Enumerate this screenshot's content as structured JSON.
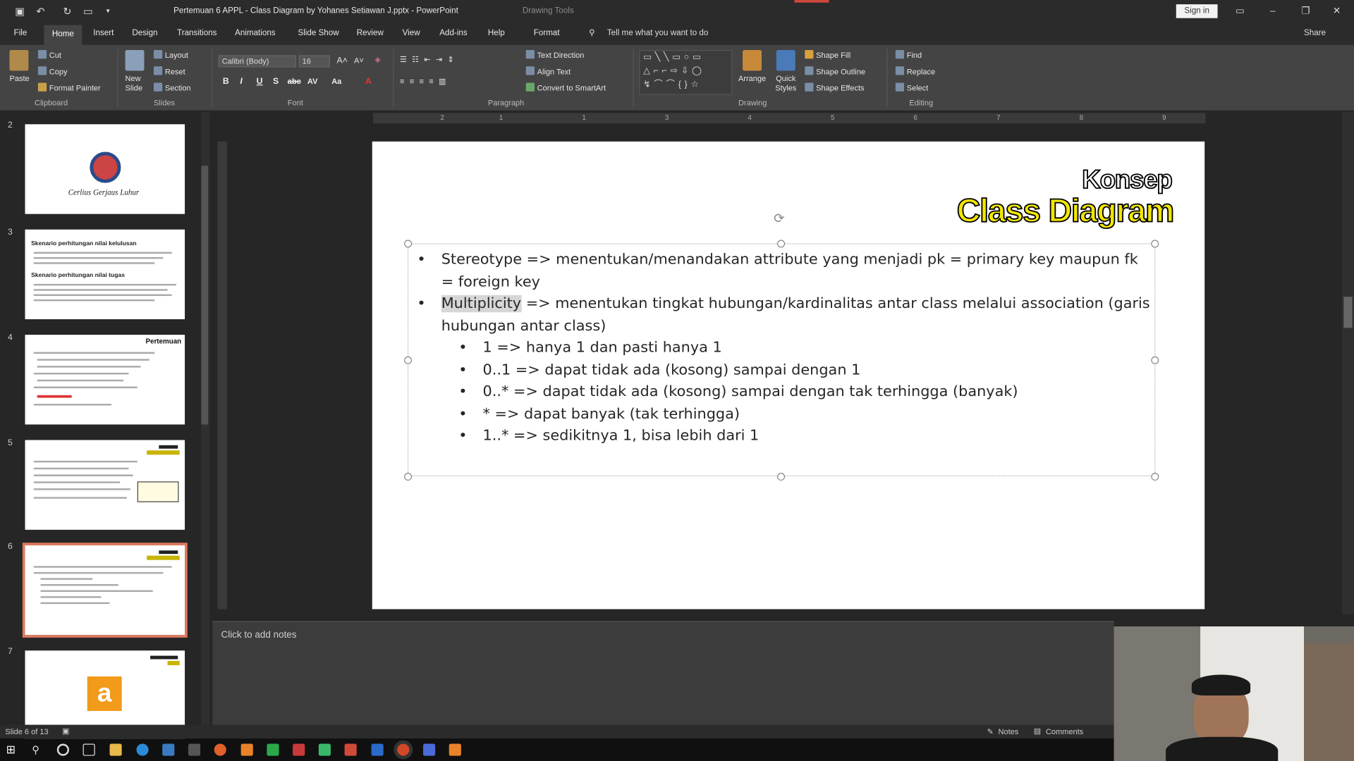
{
  "window": {
    "title": "Pertemuan 6 APPL - Class Diagram by Yohanes Setiawan J.pptx  -  PowerPoint",
    "context_group": "Drawing Tools",
    "sign_in": "Sign in"
  },
  "tabs": [
    "File",
    "Home",
    "Insert",
    "Design",
    "Transitions",
    "Animations",
    "Slide Show",
    "Review",
    "View",
    "Add-ins",
    "Help",
    "Format"
  ],
  "tell_me": "Tell me what you want to do",
  "share": "Share",
  "ribbon": {
    "clipboard": {
      "paste": "Paste",
      "cut": "Cut",
      "copy": "Copy",
      "format_painter": "Format Painter",
      "group": "Clipboard"
    },
    "slides": {
      "new_slide": "New Slide",
      "layout": "Layout",
      "reset": "Reset",
      "section": "Section",
      "group": "Slides"
    },
    "font": {
      "name": "Calibri (Body)",
      "size": "16",
      "group": "Font"
    },
    "paragraph": {
      "text_direction": "Text Direction",
      "align_text": "Align Text",
      "convert": "Convert to SmartArt",
      "group": "Paragraph"
    },
    "drawing": {
      "arrange": "Arrange",
      "quick_styles": "Quick Styles",
      "shape_fill": "Shape Fill",
      "shape_outline": "Shape Outline",
      "shape_effects": "Shape Effects",
      "group": "Drawing"
    },
    "editing": {
      "find": "Find",
      "replace": "Replace",
      "select": "Select",
      "group": "Editing"
    }
  },
  "thumbnails": [
    "2",
    "3",
    "4",
    "5",
    "6",
    "7"
  ],
  "thumb_text": {
    "t2_caption": "Cerlius Gerjaus Luhur",
    "t3_h1": "Skenario perhitungan nilai kelulusan",
    "t3_h2": "Skenario perhitungan nilai tugas",
    "t4_title": "Pertemuan"
  },
  "ruler": [
    "2",
    "1",
    "1",
    "2",
    "3",
    "4",
    "5",
    "6",
    "7",
    "8",
    "9"
  ],
  "slide": {
    "title_line1": "Konsep",
    "title_line2": "Class Diagram",
    "bullets": [
      {
        "text": "Stereotype => menentukan/menandakan attribute yang menjadi pk = primary key maupun fk = foreign key"
      },
      {
        "highlight": "Multiplicity",
        "text": " => menentukan tingkat hubungan/kardinalitas antar class melalui association (garis hubungan antar class)"
      }
    ],
    "sub_bullets": [
      "1 => hanya 1 dan pasti hanya 1",
      "0..1 => dapat tidak ada (kosong) sampai dengan 1",
      "0..* => dapat tidak ada (kosong) sampai dengan tak terhingga (banyak)",
      "* => dapat banyak (tak terhingga)",
      "1..* => sedikitnya 1, bisa lebih dari 1"
    ]
  },
  "notes_placeholder": "Click to add notes",
  "status": {
    "slide_info": "Slide 6 of 13",
    "notes": "Notes",
    "comments": "Comments"
  },
  "colors": {
    "accent": "#d0473c",
    "title_yellow": "#f2e600",
    "selection": "#e07a5f"
  }
}
